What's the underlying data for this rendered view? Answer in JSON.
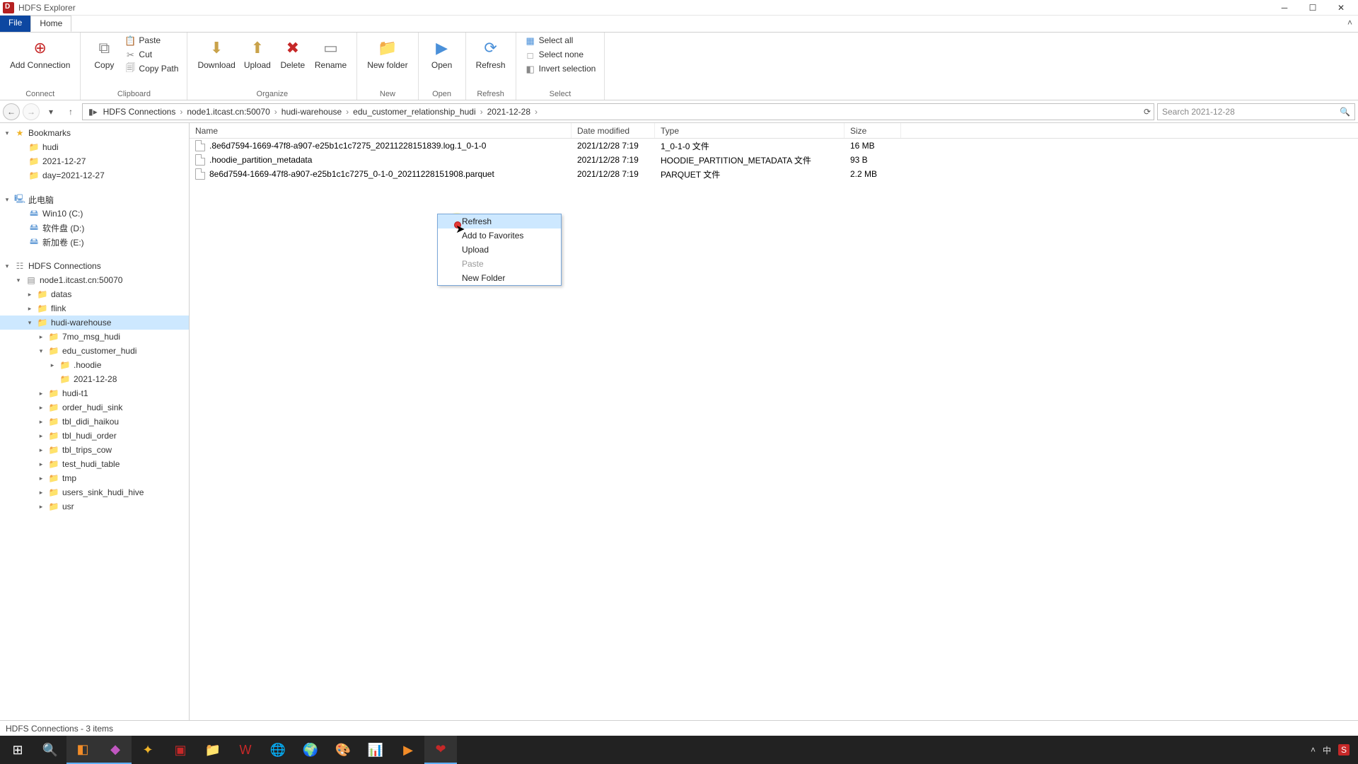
{
  "window": {
    "title": "HDFS Explorer"
  },
  "menubar": {
    "file": "File",
    "home": "Home"
  },
  "ribbon": {
    "connect": {
      "add_connection": "Add Connection",
      "group": "Connect"
    },
    "clipboard": {
      "copy": "Copy",
      "paste": "Paste",
      "cut": "Cut",
      "copy_path": "Copy Path",
      "group": "Clipboard"
    },
    "organize": {
      "download": "Download",
      "upload": "Upload",
      "delete": "Delete",
      "rename": "Rename",
      "group": "Organize"
    },
    "new": {
      "new_folder": "New folder",
      "group": "New"
    },
    "open": {
      "open": "Open",
      "group": "Open"
    },
    "refresh": {
      "refresh": "Refresh",
      "group": "Refresh"
    },
    "select": {
      "select_all": "Select all",
      "select_none": "Select none",
      "invert": "Invert selection",
      "group": "Select"
    }
  },
  "breadcrumb": {
    "segments": [
      "HDFS Connections",
      "node1.itcast.cn:50070",
      "hudi-warehouse",
      "edu_customer_relationship_hudi",
      "2021-12-28"
    ]
  },
  "search": {
    "placeholder": "Search 2021-12-28"
  },
  "sidebar": {
    "bookmarks": {
      "label": "Bookmarks",
      "items": [
        "hudi",
        "2021-12-27",
        "day=2021-12-27"
      ]
    },
    "computer": {
      "label": "此电脑",
      "items": [
        "Win10 (C:)",
        "软件盘 (D:)",
        "新加卷 (E:)"
      ]
    },
    "hdfs": {
      "label": "HDFS Connections",
      "node": "node1.itcast.cn:50070",
      "children": [
        "datas",
        "flink"
      ],
      "hudi_warehouse": "hudi-warehouse",
      "hw_children_before": [
        "7mo_msg_hudi"
      ],
      "edu": "edu_customer_hudi",
      "edu_children": [
        ".hoodie",
        "2021-12-28"
      ],
      "hw_children_after": [
        "hudi-t1",
        "order_hudi_sink",
        "tbl_didi_haikou",
        "tbl_hudi_order",
        "tbl_trips_cow",
        "test_hudi_table",
        "tmp",
        "users_sink_hudi_hive",
        "usr"
      ]
    }
  },
  "columns": {
    "name": "Name",
    "date": "Date modified",
    "type": "Type",
    "size": "Size"
  },
  "files": [
    {
      "name": ".8e6d7594-1669-47f8-a907-e25b1c1c7275_20211228151839.log.1_0-1-0",
      "date": "2021/12/28 7:19",
      "type": "1_0-1-0 文件",
      "size": "16 MB"
    },
    {
      "name": ".hoodie_partition_metadata",
      "date": "2021/12/28 7:19",
      "type": "HOODIE_PARTITION_METADATA 文件",
      "size": "93 B"
    },
    {
      "name": "8e6d7594-1669-47f8-a907-e25b1c1c7275_0-1-0_20211228151908.parquet",
      "date": "2021/12/28 7:19",
      "type": "PARQUET 文件",
      "size": "2.2 MB"
    }
  ],
  "contextmenu": {
    "refresh": "Refresh",
    "add_fav": "Add to Favorites",
    "upload": "Upload",
    "paste": "Paste",
    "new_folder": "New Folder"
  },
  "status": "HDFS Connections - 3 items",
  "tray": {
    "ime1": "中",
    "ime2": "S"
  }
}
